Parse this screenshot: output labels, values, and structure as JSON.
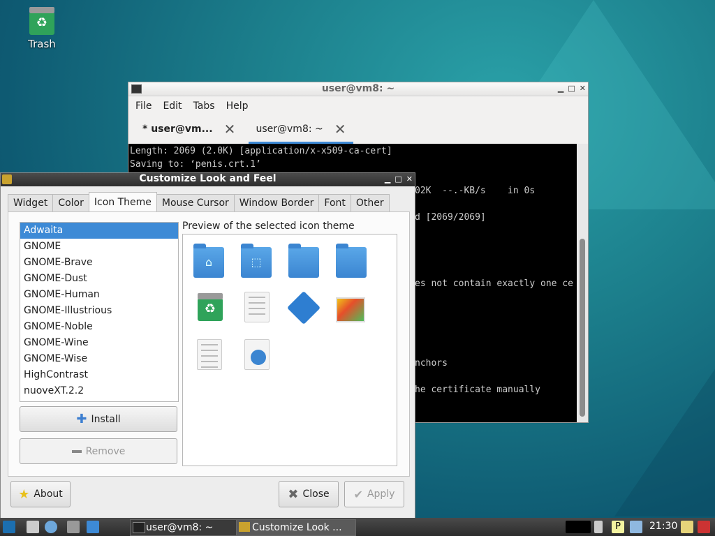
{
  "desktop": {
    "trash_label": "Trash"
  },
  "terminal": {
    "title": "user@vm8: ~",
    "menu": [
      "File",
      "Edit",
      "Tabs",
      "Help"
    ],
    "tabs": [
      {
        "label": "* user@vm..."
      },
      {
        "label": "user@vm8: ~"
      }
    ],
    "lines": [
      "Length: 2069 (2.0K) [application/x-x509-ca-cert]",
      "Saving to: ‘penis.crt.1’",
      "02K  --.-KB/s    in 0s",
      "d [2069/2069]",
      "es not contain exactly one ce",
      "nchors",
      "he certificate manually"
    ]
  },
  "dialog": {
    "title": "Customize Look and Feel",
    "tabs": [
      "Widget",
      "Color",
      "Icon Theme",
      "Mouse Cursor",
      "Window Border",
      "Font",
      "Other"
    ],
    "active_tab": "Icon Theme",
    "themes": [
      "Adwaita",
      "GNOME",
      "GNOME-Brave",
      "GNOME-Dust",
      "GNOME-Human",
      "GNOME-Illustrious",
      "GNOME-Noble",
      "GNOME-Wine",
      "GNOME-Wise",
      "HighContrast",
      "nuoveXT.2.2"
    ],
    "selected_theme": "Adwaita",
    "preview_label": "Preview of the selected icon theme",
    "install_label": "Install",
    "remove_label": "Remove",
    "about_label": "About",
    "close_label": "Close",
    "apply_label": "Apply"
  },
  "taskbar": {
    "tasks": [
      {
        "label": "user@vm8: ~"
      },
      {
        "label": "Customize Look ..."
      }
    ],
    "clock": "21:30"
  },
  "colors": {
    "selection": "#3d8ad6",
    "folder": "#3b85d1"
  }
}
